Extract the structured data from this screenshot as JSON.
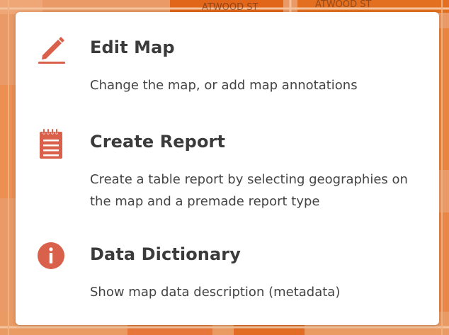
{
  "background": {
    "street_labels": [
      "ATWOOD ST",
      "ATWOOD ST"
    ]
  },
  "menu": {
    "items": [
      {
        "title": "Edit Map",
        "description": "Change the map, or add map annotations",
        "icon": "pencil-icon"
      },
      {
        "title": "Create Report",
        "description": "Create a table report by selecting geographies on the map and a premade report type",
        "icon": "notepad-icon"
      },
      {
        "title": "Data Dictionary",
        "description": "Show map data description (metadata)",
        "icon": "info-icon"
      }
    ]
  },
  "colors": {
    "accent": "#d9604a",
    "map_orange": "#e7925c",
    "map_dark_orange": "#e16a1c",
    "title_text": "#3b3b3b",
    "body_text": "#444444"
  }
}
